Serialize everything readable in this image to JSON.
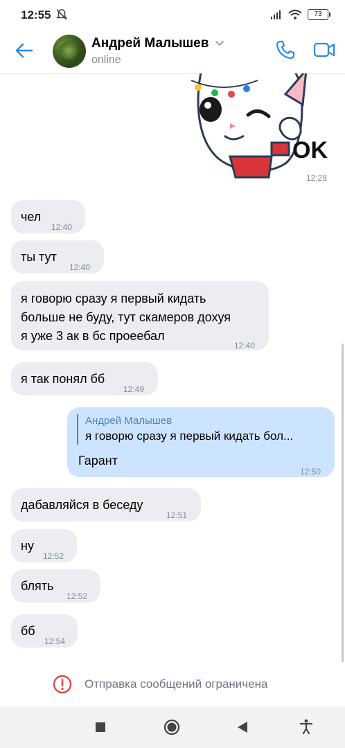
{
  "status": {
    "time": "12:55",
    "battery": "73"
  },
  "header": {
    "name": "Андрей Малышев",
    "status": "online"
  },
  "sticker": {
    "text": "OK",
    "time": "12:28"
  },
  "messages": [
    {
      "text": "чел",
      "time": "12:40"
    },
    {
      "text": "ты тут",
      "time": "12:40"
    },
    {
      "lines": [
        "я говорю сразу я первый кидать",
        "больше не буду, тут скамеров дохуя",
        "я уже 3 ак в бс проеебал"
      ],
      "time": "12:40"
    },
    {
      "text": "я так понял бб",
      "time": "12:49"
    },
    {
      "reply_name": "Андрей Малышев",
      "reply_text": "я говорю сразу я первый кидать бол...",
      "text": "Гарант",
      "time": "12:50"
    },
    {
      "text": "дабавляйся в беседу",
      "time": "12:51"
    },
    {
      "text": "ну",
      "time": "12:52"
    },
    {
      "text": "блять",
      "time": "12:52"
    },
    {
      "text": "бб",
      "time": "12:54"
    }
  ],
  "restriction": {
    "text": "Отправка сообщений ограничена"
  },
  "colors": {
    "accent": "#5181b8",
    "incoming": "#ebedf0",
    "outgoing": "#cce4ff",
    "alert": "#e64646"
  },
  "icons": [
    "mute-bell-icon",
    "signal-icon",
    "wifi-icon",
    "battery-icon",
    "back-arrow-icon",
    "chevron-down-icon",
    "phone-icon",
    "video-camera-icon",
    "alert-circle-icon",
    "nav-recent-icon",
    "nav-home-icon",
    "nav-back-icon",
    "accessibility-icon"
  ]
}
